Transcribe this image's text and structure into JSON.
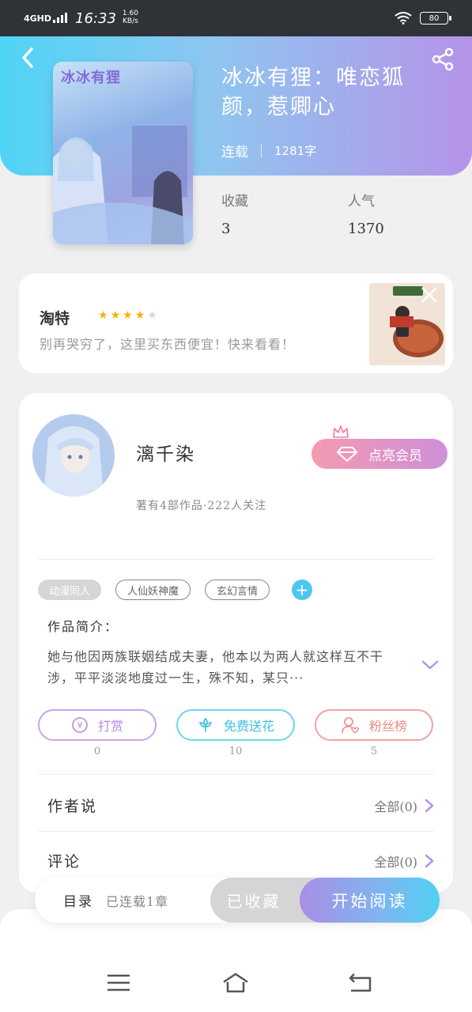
{
  "status_bar": {
    "network": "4GHD",
    "time": "16:33",
    "speed_value": "1.60",
    "speed_unit": "KB/s",
    "battery": "80"
  },
  "book": {
    "title": "冰冰有狸：唯恋狐颜，惹卿心",
    "status": "连载",
    "word_count": "1281字",
    "favorites_label": "收藏",
    "favorites_value": "3",
    "popularity_label": "人气",
    "popularity_value": "1370",
    "cover_text": "冰冰有狸"
  },
  "ad": {
    "name": "淘特",
    "rating": 4,
    "rating_max": 5,
    "description": "别再哭穷了，这里买东西便宜！快来看看！"
  },
  "author": {
    "name": "漓千染",
    "stats": "著有4部作品·222人关注",
    "vip_label": "点亮会员"
  },
  "tags": [
    "动漫同人",
    "人仙妖神魔",
    "玄幻言情"
  ],
  "intro": {
    "label": "作品简介：",
    "text": "她与他因两族联姻结成夫妻，他本以为两人就这样互不干涉，平平淡淡地度过一生，殊不知，某只···"
  },
  "actions": [
    {
      "label": "打赏",
      "count": "0",
      "color": "#b48be0"
    },
    {
      "label": "免费送花",
      "count": "10",
      "color": "#4fcbe6"
    },
    {
      "label": "粉丝榜",
      "count": "5",
      "color": "#ef8b8b"
    }
  ],
  "rows": {
    "author_says_label": "作者说",
    "author_says_value": "全部(0)",
    "comments_label": "评论",
    "comments_value": "全部(0)"
  },
  "bottom_bar": {
    "toc_label": "目录",
    "toc_status": "已连载1章",
    "collected_label": "已收藏",
    "read_label": "开始阅读"
  },
  "colors": {
    "accent_purple": "#b593e8",
    "accent_cyan": "#4fd4f6",
    "star": "#f5b301"
  }
}
